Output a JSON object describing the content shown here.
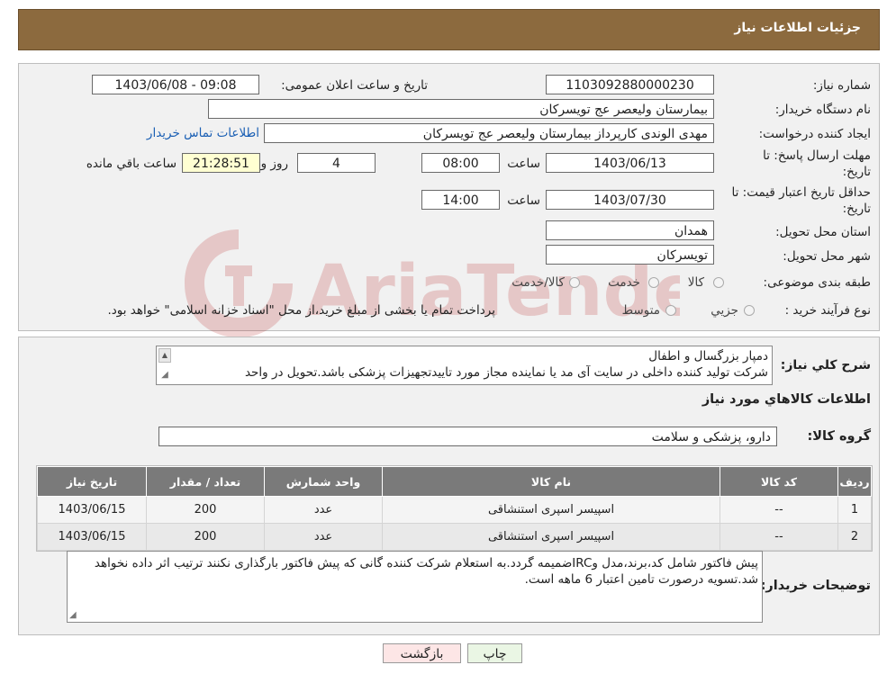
{
  "header": {
    "title": "جزئیات اطلاعات نیاز"
  },
  "form": {
    "need_number": {
      "label": "شماره نیاز:",
      "value": "1103092880000230"
    },
    "announce_datetime": {
      "label": "تاریخ و ساعت اعلان عمومی:",
      "value": "1403/06/08 - 09:08"
    },
    "buyer_org": {
      "label": "نام دستگاه خریدار:",
      "value": "بیمارستان ولیعصر  عج  تویسرکان"
    },
    "creator": {
      "label": "ایجاد کننده درخواست:",
      "value": "مهدی الوندی کارپرداز بیمارستان ولیعصر  عج  تویسرکان",
      "contact_link": "اطلاعات تماس خریدار"
    },
    "reply_deadline": {
      "label": "مهلت ارسال پاسخ: تا تاریخ:",
      "date": "1403/06/13",
      "time_label": "ساعت",
      "time": "08:00",
      "days": "4",
      "days_label": "روز و",
      "remaining": "21:28:51",
      "remaining_label": "ساعت باقي مانده"
    },
    "price_validity": {
      "label": "حداقل تاریخ اعتبار قیمت: تا تاریخ:",
      "date": "1403/07/30",
      "time_label": "ساعت",
      "time": "14:00"
    },
    "province": {
      "label": "استان محل تحویل:",
      "value": "همدان"
    },
    "city": {
      "label": "شهر محل تحویل:",
      "value": "تویسرکان"
    },
    "category": {
      "label": "طبقه بندی موضوعی:",
      "options": [
        "کالا",
        "خدمت",
        "کالا/خدمت"
      ]
    },
    "purchase_process": {
      "label": "نوع فرآیند خرید :",
      "options": [
        "جزیي",
        "متوسط"
      ],
      "note": "پرداخت تمام یا بخشی از مبلغ خرید،از محل \"اسناد خزانه اسلامی\" خواهد بود."
    }
  },
  "description": {
    "label": "شرح کلي نياز:",
    "line1": "دمپار بزرگسال و اطفال",
    "line2": "شرکت تولید کننده داخلی در سایت آی مد یا نماینده مجاز مورد تاییدتجهیزات پزشکی باشد.تحویل در واحد"
  },
  "goods_section": {
    "title": "اطلاعات کالاهاي مورد نياز",
    "group_label": "گروه کالا:",
    "group_value": "دارو، پزشکی و سلامت"
  },
  "table": {
    "headers": [
      "ردیف",
      "کد کالا",
      "نام کالا",
      "واحد شمارش",
      "تعداد / مقدار",
      "تاریخ نیاز"
    ],
    "rows": [
      [
        "1",
        "--",
        "اسپیسر اسپری استنشاقی",
        "عدد",
        "200",
        "1403/06/15"
      ],
      [
        "2",
        "--",
        "اسپیسر اسپری استنشاقی",
        "عدد",
        "200",
        "1403/06/15"
      ]
    ]
  },
  "buyer_notes": {
    "label": "توضیحات خریدار:",
    "text": "پیش فاکتور شامل کد،برند،مدل وIRCضمیمه گردد.به استعلام شرکت کننده گانی که پیش فاکتور بارگذاری نکنند ترتیب اثر داده نخواهد شد.تسویه درصورت تامین اعتبار 6 ماهه است."
  },
  "buttons": {
    "print": "چاپ",
    "back": "بازگشت"
  },
  "colors": {
    "header_bg": "#8c6a3e",
    "table_header_bg": "#7a7a7a",
    "link": "#1a5fb4",
    "back_button_bg": "#fde6e6",
    "print_button_bg": "#eaf6e4",
    "remaining_bg": "#ffffd2"
  }
}
